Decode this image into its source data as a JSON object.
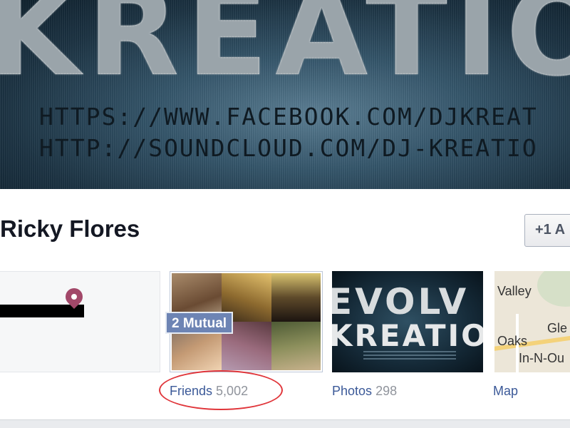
{
  "cover": {
    "logo_text": "KREATION",
    "line1": "HTTPS://WWW.FACEBOOK.COM/DJKREAT",
    "line2": "HTTP://SOUNDCLOUD.COM/DJ-KREATIO"
  },
  "profile": {
    "name": "Ricky Flores",
    "add_friend_label": "+1 A"
  },
  "tiles": {
    "friends": {
      "label": "Friends",
      "count": "5,002",
      "mutual_badge": "2 Mutual"
    },
    "photos": {
      "label": "Photos",
      "count": "298",
      "cover_word1": "EVOLV",
      "cover_word2": "KREATION"
    },
    "map": {
      "label": "Map",
      "places": [
        "Valley",
        "Oaks",
        "Gle",
        "In-N-Ou"
      ]
    }
  },
  "annotation": {
    "color": "#e0353a"
  }
}
